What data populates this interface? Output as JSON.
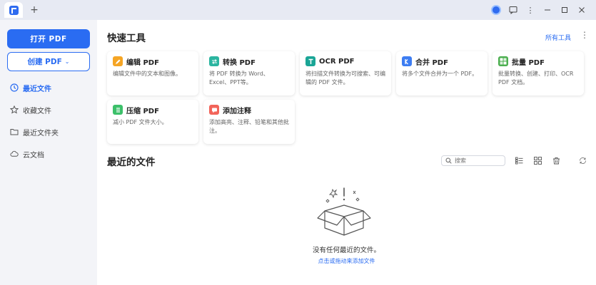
{
  "titlebar": {
    "new_tab": "+",
    "controls": [
      "app-badge",
      "comment",
      "more",
      "minimize",
      "maximize",
      "close"
    ]
  },
  "sidebar": {
    "open_button": "打开 PDF",
    "create_button": "创建 PDF",
    "create_chevron": "⌄",
    "nav": [
      {
        "label": "最近文件",
        "icon": "clock-icon",
        "active": true
      },
      {
        "label": "收藏文件",
        "icon": "star-icon",
        "active": false
      },
      {
        "label": "最近文件夹",
        "icon": "folder-icon",
        "active": false
      },
      {
        "label": "云文档",
        "icon": "cloud-icon",
        "active": false
      }
    ]
  },
  "main": {
    "quick_tools_title": "快速工具",
    "all_tools_link": "所有工具",
    "tools": [
      {
        "title": "编辑 PDF",
        "desc": "编辑文件中的文本和图像。",
        "color": "#f5a524",
        "icon": "edit-pdf-icon"
      },
      {
        "title": "转换 PDF",
        "desc": "将 PDF 转换为 Word、Excel、PPT等。",
        "color": "#2bb5a0",
        "icon": "convert-pdf-icon"
      },
      {
        "title": "OCR PDF",
        "desc": "将扫描文件转换为可搜索、可编辑的 PDF 文件。",
        "color": "#1aa596",
        "icon": "ocr-pdf-icon"
      },
      {
        "title": "合并 PDF",
        "desc": "将多个文件合并为一个 PDF。",
        "color": "#3d7df2",
        "icon": "merge-pdf-icon"
      },
      {
        "title": "批量 PDF",
        "desc": "批量转换、创建、打印、OCR PDF 文档。",
        "color": "#4caf50",
        "icon": "batch-pdf-icon"
      },
      {
        "title": "压缩 PDF",
        "desc": "减小 PDF 文件大小。",
        "color": "#3cc06a",
        "icon": "compress-pdf-icon"
      },
      {
        "title": "添加注释",
        "desc": "添加高亮、注释、铅笔和其他批注。",
        "color": "#f2645a",
        "icon": "annotate-icon"
      }
    ],
    "recent_title": "最近的文件",
    "search_placeholder": "搜索",
    "empty_title": "没有任何最近的文件。",
    "empty_sub": "点击或拖动来添加文件"
  }
}
